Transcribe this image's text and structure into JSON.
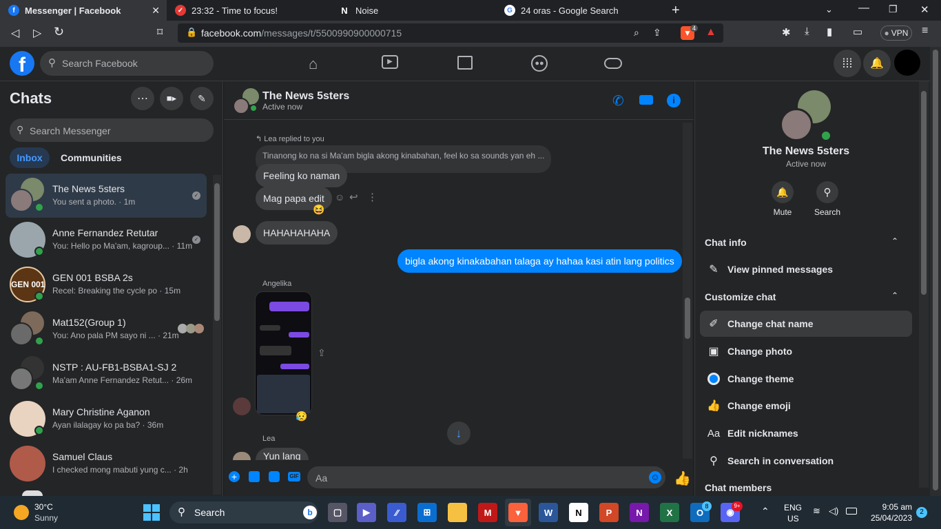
{
  "browser": {
    "tabs": [
      {
        "title": "Messenger | Facebook",
        "favicon": "facebook-icon"
      },
      {
        "title": "23:32 - Time to focus!",
        "favicon": "check-icon"
      },
      {
        "title": "Noise",
        "favicon": "notion-icon"
      },
      {
        "title": "24 oras - Google Search",
        "favicon": "google-icon"
      }
    ],
    "url_domain": "facebook.com",
    "url_path": "/messages/t/5500990900000715",
    "vpn_label": "VPN",
    "brave_badge": "4"
  },
  "fb_header": {
    "search_placeholder": "Search Facebook"
  },
  "sidebar": {
    "title": "Chats",
    "search_placeholder": "Search Messenger",
    "tabs": [
      "Inbox",
      "Communities"
    ],
    "chats": [
      {
        "name": "The News 5sters",
        "preview": "You sent a photo. · 1m"
      },
      {
        "name": "Anne Fernandez Retutar",
        "preview": "You: Hello po Ma'am, kagroup... · 11m"
      },
      {
        "name": "GEN 001 BSBA 2s",
        "preview": "Recel: Breaking the cycle po · 15m",
        "avatar_text": "GEN 001"
      },
      {
        "name": "Mat152(Group 1)",
        "preview": "You: Ano pala PM sayo ni ... · 21m"
      },
      {
        "name": "NSTP : AU-FB1-BSBA1-SJ 2",
        "preview": "Ma'am Anne Fernandez Retut... · 26m"
      },
      {
        "name": "Mary Christine Aganon",
        "preview": "Ayan ilalagay ko pa ba? · 36m"
      },
      {
        "name": "Samuel Claus",
        "preview": "I checked mong mabuti yung c... · 2h"
      }
    ]
  },
  "conversation": {
    "name": "The News 5sters",
    "status": "Active now",
    "replied_label": "Lea replied to you",
    "quoted": "Tinanong ko na si Ma'am bigla akong kinabahan, feel ko sa sounds yan eh ...",
    "messages": [
      {
        "text": "Feeling ko naman"
      },
      {
        "text": "Mag papa edit",
        "reaction": "😆"
      },
      {
        "text": "HAHAHAHAHA"
      },
      {
        "text": "bigla akong kinakabahan talaga ay hahaa kasi atin lang politics",
        "mine": true
      }
    ],
    "photo_sender": "Angelika",
    "photo_reaction": "😥",
    "last_sender": "Lea",
    "last_text": "Yun lang",
    "composer_placeholder": "Aa"
  },
  "info_panel": {
    "name": "The News 5sters",
    "status": "Active now",
    "actions": [
      "Mute",
      "Search"
    ],
    "sections": [
      {
        "title": "Chat info",
        "items": [
          "View pinned messages"
        ]
      },
      {
        "title": "Customize chat",
        "items": [
          "Change chat name",
          "Change photo",
          "Change theme",
          "Change emoji",
          "Edit nicknames",
          "Search in conversation"
        ]
      }
    ],
    "next_section_partial": "Chat members"
  },
  "taskbar": {
    "weather_temp": "30°C",
    "weather_desc": "Sunny",
    "search_label": "Search",
    "lang_top": "ENG",
    "lang_bottom": "US",
    "time": "9:05 am",
    "date": "25/04/2023",
    "notif_count": "2",
    "outlook_badge": "8",
    "discord_badge": "9+"
  },
  "colors": {
    "accent": "#0084ff",
    "fb_blue": "#1877f2",
    "online": "#31a24c"
  }
}
